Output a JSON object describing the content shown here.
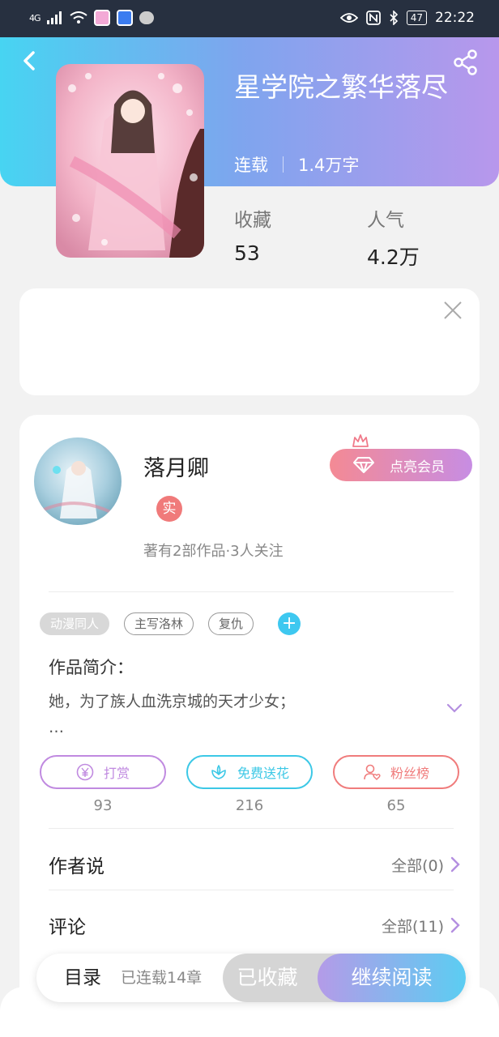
{
  "status_bar": {
    "network": "4G",
    "battery": "47",
    "time": "22:22"
  },
  "book": {
    "title": "星学院之繁华落尽",
    "status": "连载",
    "word_count": "1.4万字",
    "favorites_label": "收藏",
    "favorites_value": "53",
    "popularity_label": "人气",
    "popularity_value": "4.2万"
  },
  "author": {
    "name": "落月卿",
    "badge": "实",
    "stats": "著有2部作品·3人关注",
    "vip_button": "点亮会员"
  },
  "tags": [
    "动漫同人",
    "主写洛林",
    "复仇"
  ],
  "tag_add": "+",
  "intro": {
    "title": "作品简介：",
    "text": "她，为了族人血洗京城的天才少女；",
    "ellipsis": "…"
  },
  "actions": [
    {
      "label": "打赏",
      "count": "93",
      "color": "#c08ae0",
      "icon": "yen-icon"
    },
    {
      "label": "免费送花",
      "count": "216",
      "color": "#3cc8e6",
      "icon": "flower-icon"
    },
    {
      "label": "粉丝榜",
      "count": "65",
      "color": "#f07c7c",
      "icon": "fan-icon"
    }
  ],
  "sections": {
    "author_says": {
      "title": "作者说",
      "more": "全部(0)"
    },
    "comments": {
      "title": "评论",
      "more": "全部(11)"
    }
  },
  "bottom_bar": {
    "toc": "目录",
    "chapters": "已连载14章",
    "collected": "已收藏",
    "continue": "继续阅读"
  },
  "colors": {
    "accent_cyan": "#47d4f2",
    "accent_purple": "#b897ec",
    "vip_pink": "#f48a94"
  }
}
